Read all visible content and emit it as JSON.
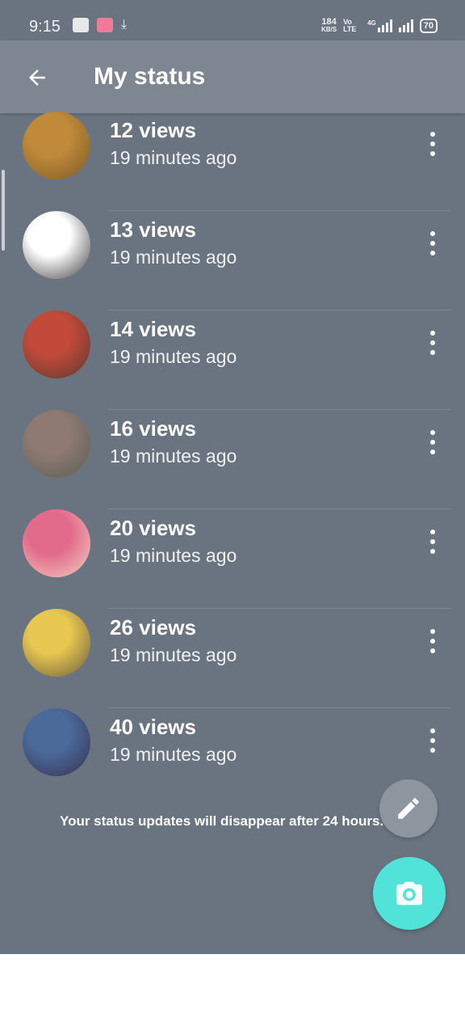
{
  "status_bar": {
    "time": "9:15",
    "speed_value": "184",
    "speed_unit": "KB/S",
    "network_type": "Vo LTE",
    "signal_label": "4G",
    "battery": "70"
  },
  "header": {
    "title": "My status"
  },
  "status_list": [
    {
      "views": "12 views",
      "time": "19 minutes ago",
      "avatar_colors": [
        "#c08a3a",
        "#7a5a28"
      ]
    },
    {
      "views": "13 views",
      "time": "19 minutes ago",
      "avatar_colors": [
        "#ffffff",
        "#404040"
      ]
    },
    {
      "views": "14 views",
      "time": "19 minutes ago",
      "avatar_colors": [
        "#c24a3a",
        "#5a3a30"
      ]
    },
    {
      "views": "16 views",
      "time": "19 minutes ago",
      "avatar_colors": [
        "#8e7a72",
        "#5b5e55"
      ]
    },
    {
      "views": "20 views",
      "time": "19 minutes ago",
      "avatar_colors": [
        "#e26a8a",
        "#f0d0c0"
      ]
    },
    {
      "views": "26 views",
      "time": "19 minutes ago",
      "avatar_colors": [
        "#e8c850",
        "#6a5a40"
      ]
    },
    {
      "views": "40 views",
      "time": "19 minutes ago",
      "avatar_colors": [
        "#4a6a9a",
        "#3a3050"
      ]
    }
  ],
  "footer_note": "Your status updates will disappear after 24 hours.",
  "colors": {
    "background": "#6a7480",
    "appbar": "#7d8691",
    "fab_camera": "#52e3d8",
    "fab_edit": "#8d959f"
  },
  "icons": {
    "back": "arrow-left-icon",
    "more": "more-vert-icon",
    "edit": "pencil-icon",
    "camera": "camera-icon"
  }
}
